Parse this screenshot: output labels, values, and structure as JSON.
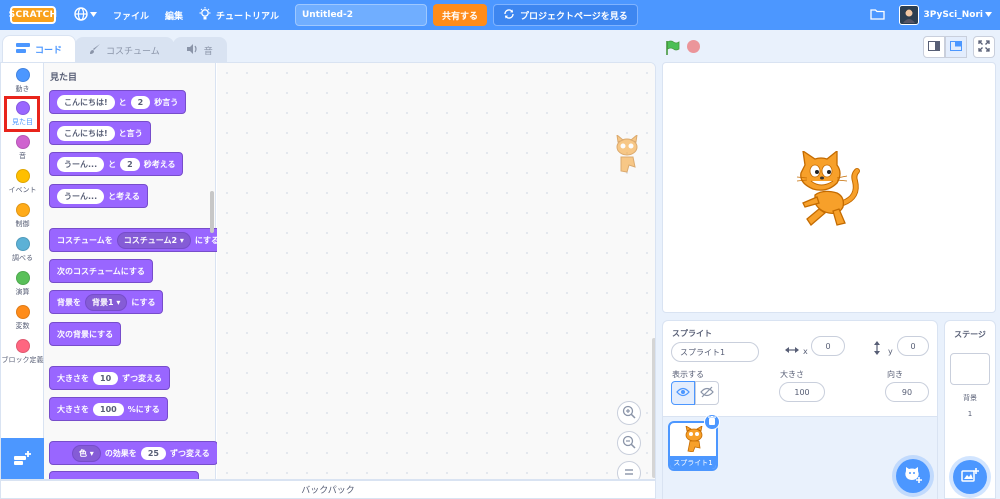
{
  "menubar": {
    "logo": "SCRATCH",
    "file": "ファイル",
    "edit": "編集",
    "tutorials": "チュートリアル",
    "project_title": "Untitled-2",
    "share": "共有する",
    "project_page": "プロジェクトページを見る",
    "username": "3PySci_Nori"
  },
  "tabs": {
    "code": "コード",
    "costumes": "コスチューム",
    "sounds": "音"
  },
  "categories": [
    {
      "label": "動き",
      "color": "#4c97ff"
    },
    {
      "label": "見た目",
      "color": "#9966ff"
    },
    {
      "label": "音",
      "color": "#cf63cf"
    },
    {
      "label": "イベント",
      "color": "#ffbf00"
    },
    {
      "label": "制御",
      "color": "#ffab19"
    },
    {
      "label": "調べる",
      "color": "#5cb1d6"
    },
    {
      "label": "演算",
      "color": "#59c059"
    },
    {
      "label": "変数",
      "color": "#ff8c1a"
    },
    {
      "label": "ブロック定義",
      "color": "#ff6680"
    }
  ],
  "palette": {
    "title": "見た目",
    "blocks": {
      "say_for": {
        "text1": "こんにちは!",
        "text2": "と",
        "num": "2",
        "text3": "秒言う"
      },
      "say": {
        "text1": "こんにちは!",
        "text2": "と言う"
      },
      "think_for": {
        "text1": "うーん...",
        "text2": "と",
        "num": "2",
        "text3": "秒考える"
      },
      "think": {
        "text1": "うーん...",
        "text2": "と考える"
      },
      "switch_costume": {
        "text1": "コスチュームを",
        "dd": "コスチューム2",
        "text2": "にする"
      },
      "next_costume": {
        "text1": "次のコスチュームにする"
      },
      "switch_backdrop": {
        "text1": "背景を",
        "dd": "背景1",
        "text2": "にする"
      },
      "next_backdrop": {
        "text1": "次の背景にする"
      },
      "change_size": {
        "text1": "大きさを",
        "num": "10",
        "text2": "ずつ変える"
      },
      "set_size": {
        "text1": "大きさを",
        "num": "100",
        "text2": "%にする"
      },
      "change_effect": {
        "dd": "色",
        "text1": "の効果を",
        "num": "25",
        "text2": "ずつ変える"
      }
    }
  },
  "backpack": "バックパック",
  "sprite_info": {
    "sprite_label": "スプライト",
    "sprite_name": "スプライト1",
    "x_label": "x",
    "x_value": "0",
    "y_label": "y",
    "y_value": "0",
    "show_label": "表示する",
    "size_label": "大きさ",
    "size_value": "100",
    "direction_label": "向き",
    "direction_value": "90",
    "thumb_name": "スプライト1"
  },
  "stage_pane": {
    "title": "ステージ",
    "backdrop_label": "背景",
    "backdrop_count": "1"
  }
}
